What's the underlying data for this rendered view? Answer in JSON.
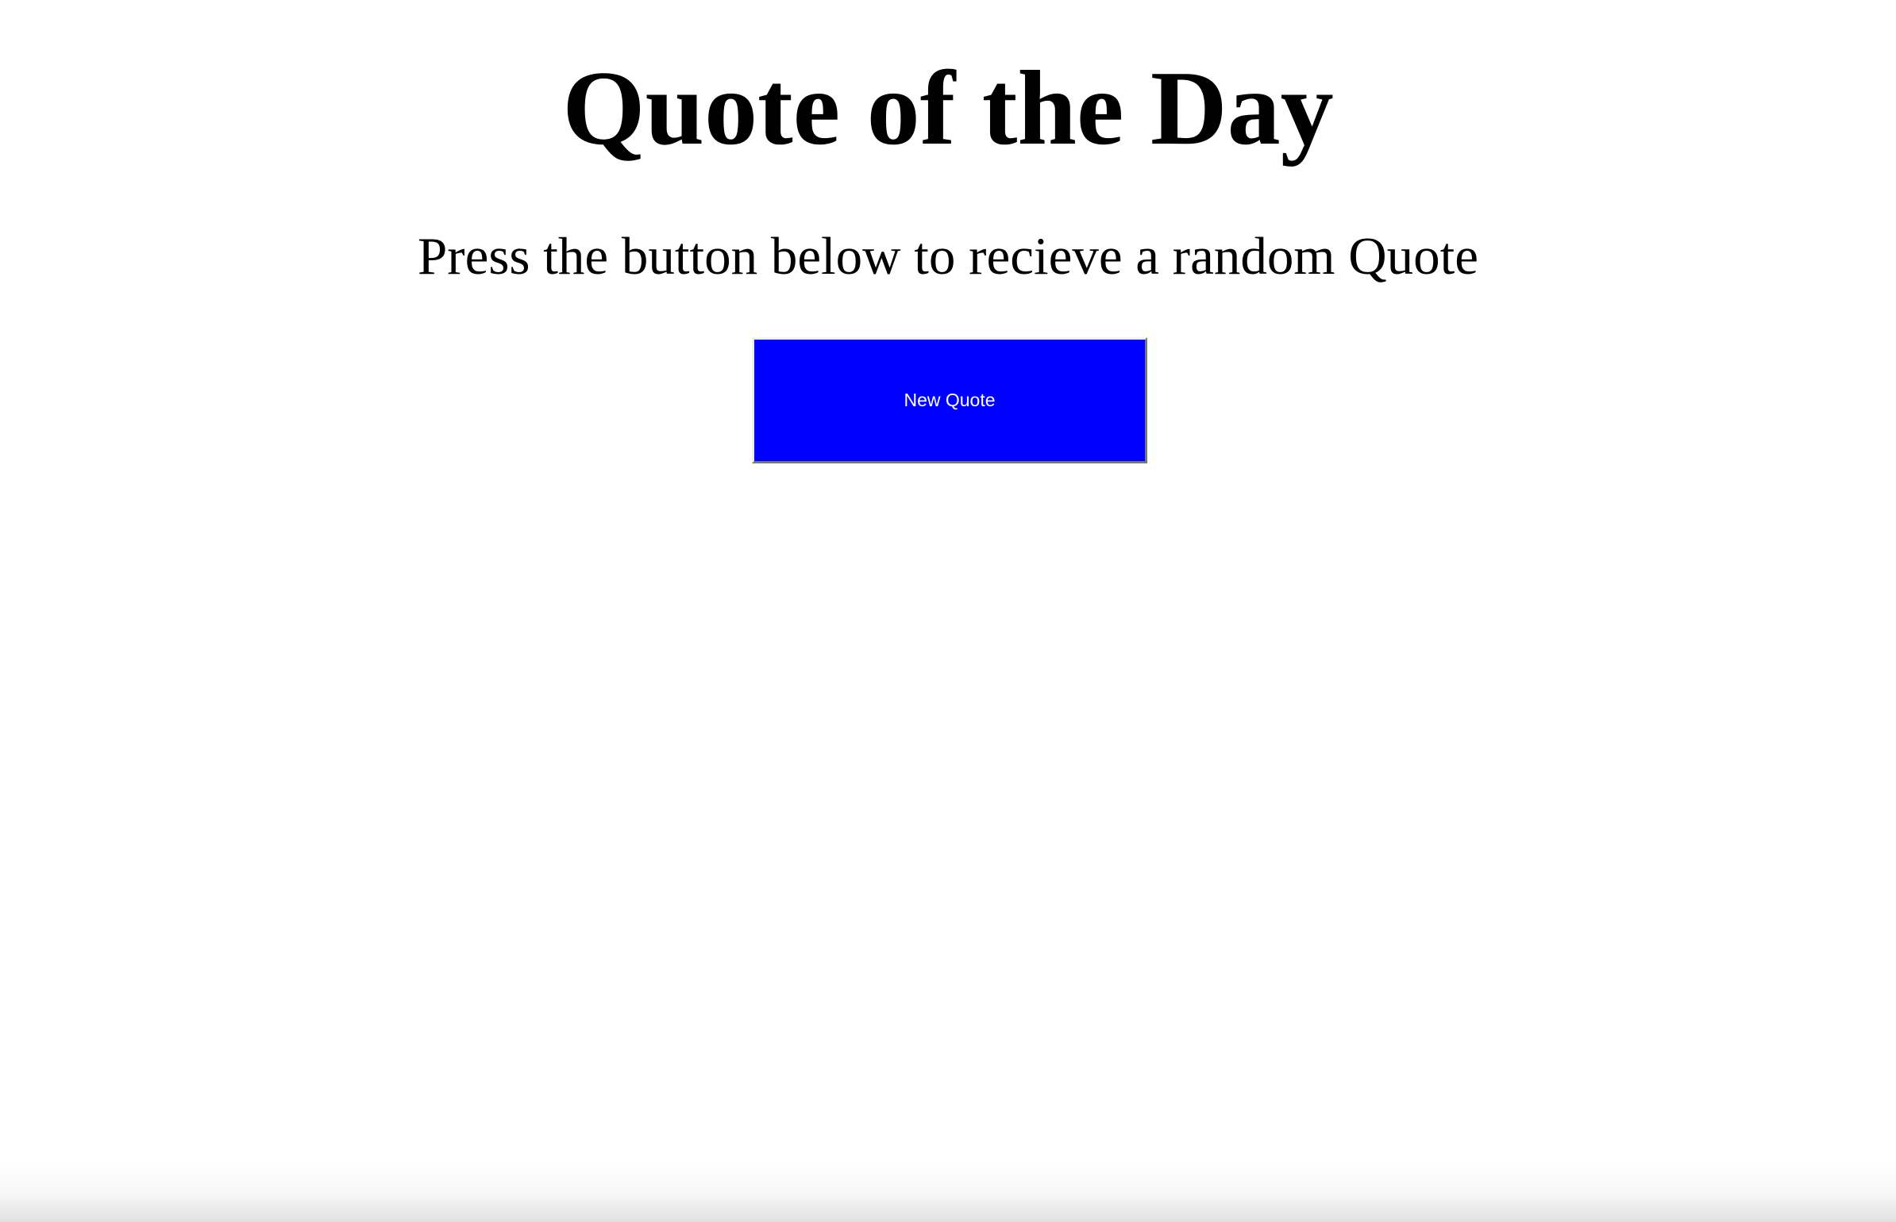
{
  "page": {
    "title": "Quote of the Day",
    "subtitle": "Press the button below to recieve a random Quote"
  },
  "button": {
    "label": "New Quote"
  },
  "colors": {
    "background": "#ffffff",
    "text": "#000000",
    "button_background": "#0000ff",
    "button_text": "#ffffff"
  }
}
